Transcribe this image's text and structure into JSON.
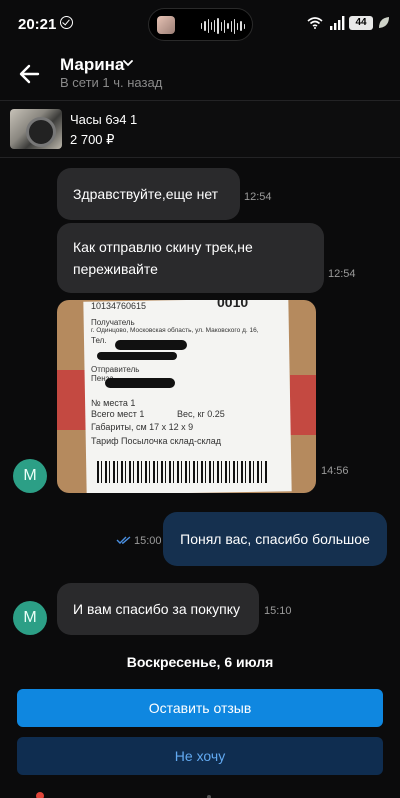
{
  "status_bar": {
    "time": "20:21",
    "battery": "44",
    "icons": [
      "check-circle-icon",
      "media-thumbnail-icon",
      "audio-wave-icon",
      "wifi-icon",
      "signal-icon",
      "battery-icon",
      "leaf-icon"
    ]
  },
  "header": {
    "contact_name": "Марина",
    "presence": "В сети 1 ч. назад",
    "icons": [
      "back-arrow-icon",
      "chevron-down-icon"
    ]
  },
  "product": {
    "title": "Часы 6э4 1",
    "price": "2 700 ₽"
  },
  "messages": [
    {
      "author": "in",
      "text": "Здравствуйте,еще нет",
      "time": "12:54"
    },
    {
      "author": "in",
      "text": "Как отправлю скину трек,не переживайте",
      "time": "12:54"
    },
    {
      "author": "in",
      "type": "photo",
      "time": "14:56",
      "avatar_letter": "M",
      "photo_text": {
        "code": "10134760615",
        "recipient_label": "Получатель",
        "recipient_addr": "г. Одинцово, Московская область, ул. Маковского д. 16,",
        "phone": "Тел.",
        "sender_label": "Отправитель",
        "sender_city": "Пенза",
        "places_no": "№ места 1",
        "places_total": "Всего мест 1",
        "weight": "Вес, кг 0.25",
        "dims": "Габариты, см 17 х 12 х 9",
        "tariff": "Тариф Посылочка склад-склад",
        "top": "0010"
      }
    },
    {
      "author": "out",
      "text": "Понял вас, спасибо большое",
      "time": "15:00"
    },
    {
      "author": "in",
      "text": "И вам спасибо за покупку",
      "time": "15:10",
      "avatar_letter": "M"
    }
  ],
  "date_separator": "Воскресенье, 6 июля",
  "actions": {
    "review": "Оставить отзыв",
    "decline": "Не хочу"
  },
  "colors": {
    "background": "#0b0b0c",
    "incoming_bubble": "#2a2a2c",
    "outgoing_bubble": "#15304f",
    "avatar": "#2c9f86",
    "primary_button": "#0f87e0",
    "secondary_button": "#0f2d50",
    "secondary_text": "#62a9f0"
  }
}
